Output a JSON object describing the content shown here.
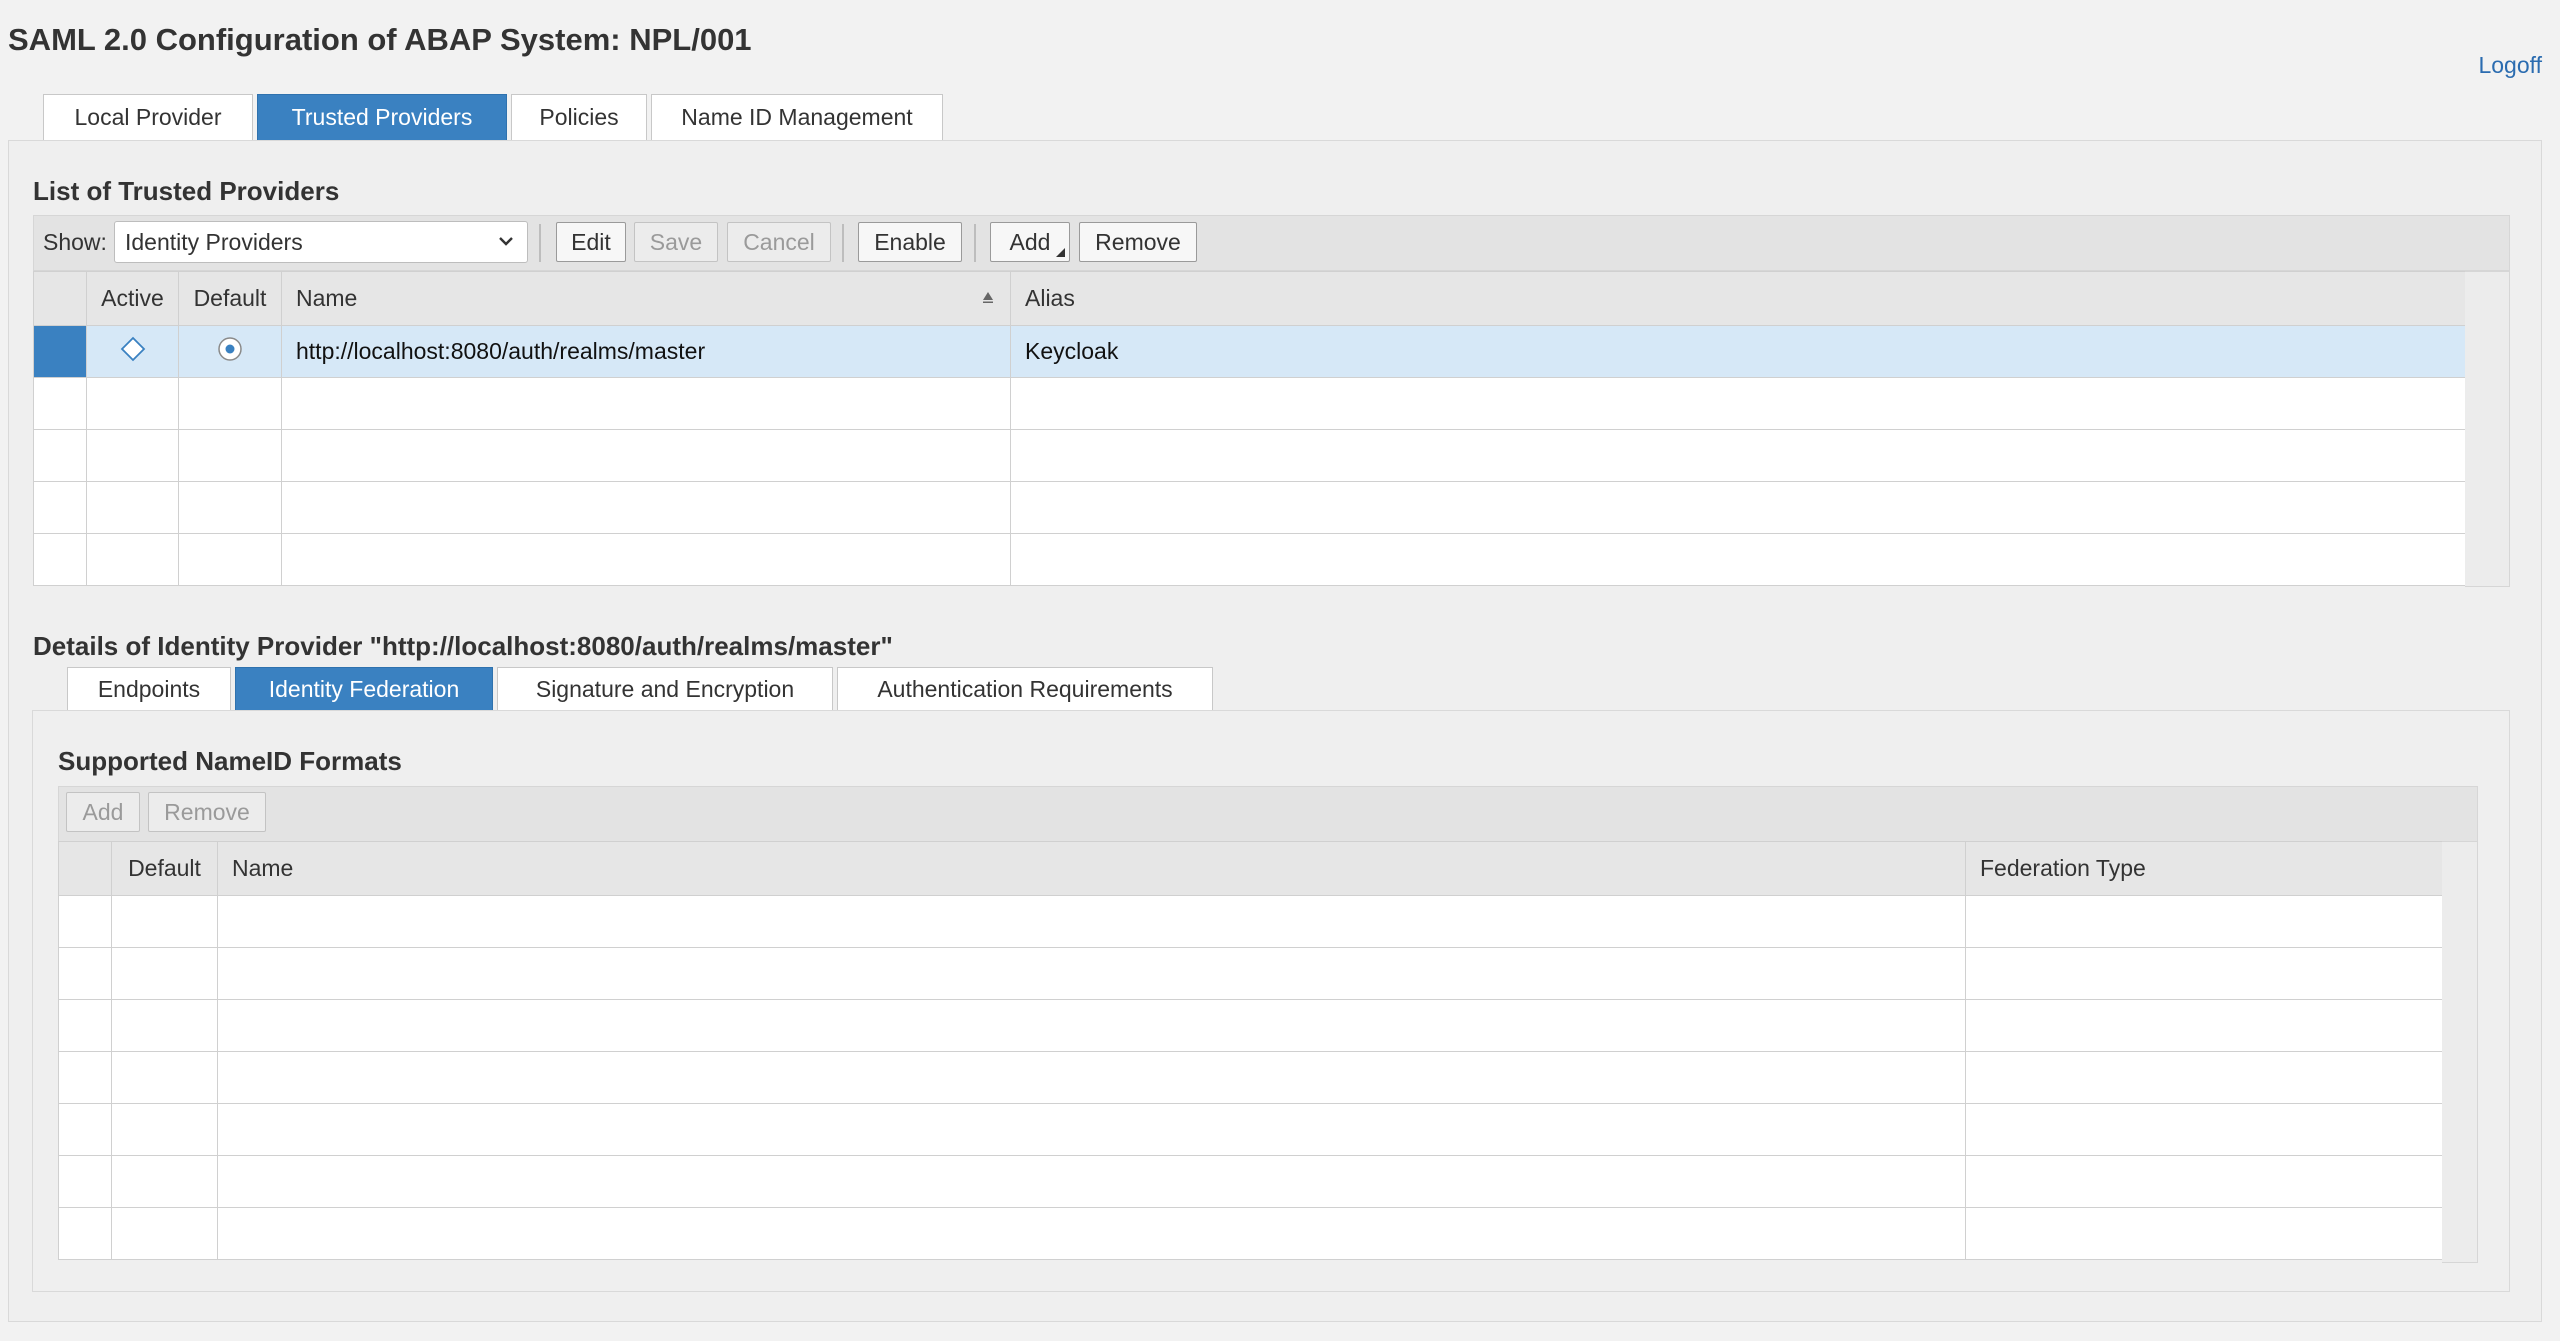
{
  "page": {
    "title": "SAML 2.0 Configuration of ABAP System: NPL/001",
    "logoff": "Logoff"
  },
  "main_tabs": [
    {
      "label": "Local Provider",
      "active": false
    },
    {
      "label": "Trusted Providers",
      "active": true
    },
    {
      "label": "Policies",
      "active": false
    },
    {
      "label": "Name ID Management",
      "active": false
    }
  ],
  "trusted_list": {
    "title": "List of Trusted Providers",
    "show_label": "Show:",
    "show_value": "Identity Providers",
    "buttons": {
      "edit": "Edit",
      "save": "Save",
      "cancel": "Cancel",
      "enable": "Enable",
      "add": "Add",
      "remove": "Remove"
    },
    "columns": {
      "active": "Active",
      "default": "Default",
      "name": "Name",
      "alias": "Alias"
    },
    "rows": [
      {
        "name": "http://localhost:8080/auth/realms/master",
        "alias": "Keycloak",
        "selected": true
      }
    ]
  },
  "details": {
    "title": "Details of Identity Provider \"http://localhost:8080/auth/realms/master\"",
    "tabs": [
      {
        "label": "Endpoints",
        "active": false
      },
      {
        "label": "Identity Federation",
        "active": true
      },
      {
        "label": "Signature and Encryption",
        "active": false
      },
      {
        "label": "Authentication Requirements",
        "active": false
      }
    ],
    "nameid": {
      "title": "Supported NameID Formats",
      "buttons": {
        "add": "Add",
        "remove": "Remove"
      },
      "columns": {
        "default": "Default",
        "name": "Name",
        "federation_type": "Federation Type"
      }
    }
  },
  "colors": {
    "accent": "#3a81c1",
    "selected_row": "#d6e8f7",
    "link": "#2b6cb0"
  }
}
